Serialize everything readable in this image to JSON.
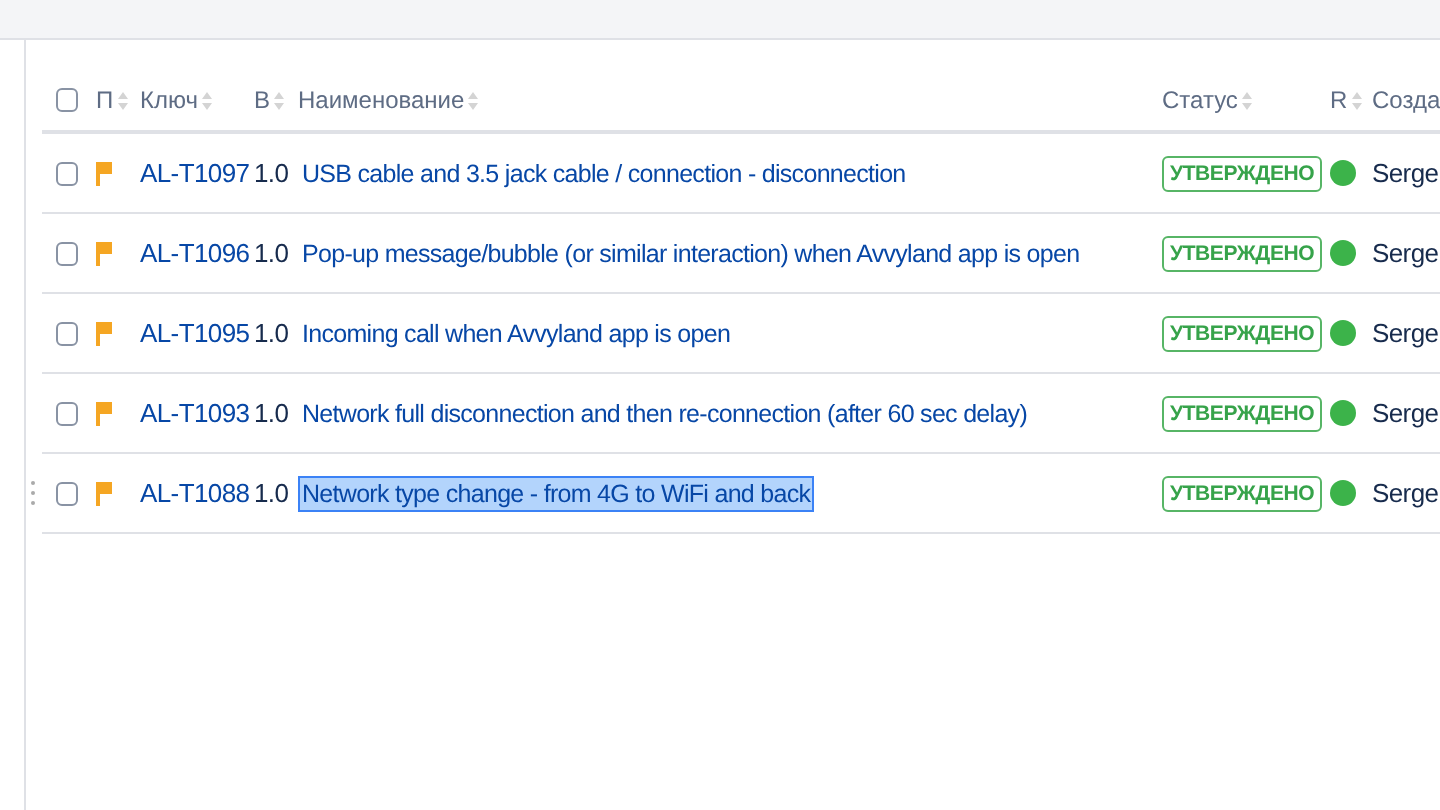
{
  "table": {
    "columns": [
      {
        "kind": "checkbox",
        "checked": false
      },
      {
        "kind": "text",
        "label": "П"
      },
      {
        "kind": "text",
        "label": "Ключ"
      },
      {
        "kind": "text",
        "label": "В"
      },
      {
        "kind": "text",
        "label": "Наименование"
      },
      {
        "kind": "text",
        "label": "Статус"
      },
      {
        "kind": "text",
        "label": "R"
      },
      {
        "kind": "text",
        "label": "Созда"
      }
    ],
    "rows": [
      {
        "checked": false,
        "key": "AL-T1097",
        "version": "1.0",
        "name": "USB cable and 3.5 jack cable / connection - disconnection",
        "name_selected": false,
        "drag_handle": false,
        "status": "УТВЕРЖДЕНО",
        "color": "#3cb34a",
        "creator": "Serge"
      },
      {
        "checked": false,
        "key": "AL-T1096",
        "version": "1.0",
        "name": "Pop-up message/bubble (or similar interaction) when Avvyland app is open",
        "name_selected": false,
        "drag_handle": false,
        "status": "УТВЕРЖДЕНО",
        "color": "#3cb34a",
        "creator": "Serge"
      },
      {
        "checked": false,
        "key": "AL-T1095",
        "version": "1.0",
        "name": "Incoming call when Avvyland app is open",
        "name_selected": false,
        "drag_handle": false,
        "status": "УТВЕРЖДЕНО",
        "color": "#3cb34a",
        "creator": "Serge"
      },
      {
        "checked": false,
        "key": "AL-T1093",
        "version": "1.0",
        "name": "Network full disconnection and then re-connection (after 60 sec delay)",
        "name_selected": false,
        "drag_handle": false,
        "status": "УТВЕРЖДЕНО",
        "color": "#3cb34a",
        "creator": "Serge"
      },
      {
        "checked": false,
        "key": "AL-T1088",
        "version": "1.0",
        "name": "Network type change - from 4G to WiFi and back",
        "name_selected": true,
        "drag_handle": true,
        "status": "УТВЕРЖДЕНО",
        "color": "#3cb34a",
        "creator": "Serge"
      }
    ]
  }
}
